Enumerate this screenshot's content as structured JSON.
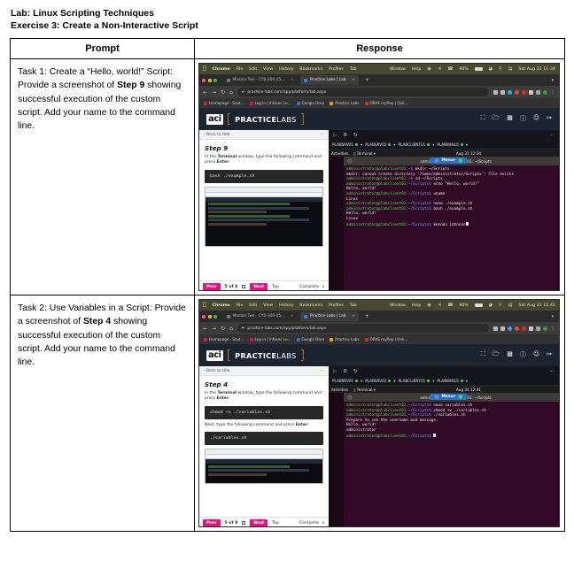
{
  "document": {
    "line1": "Lab: Linux Scripting Techniques",
    "line2": "Exercise 3: Create a Non-Interactive Script"
  },
  "table": {
    "headers": {
      "prompt": "Prompt",
      "response": "Response"
    },
    "rows": [
      {
        "prompt": {
          "part1": "Task 1: Create a “Hello, world!” Script: Provide a screenshot of ",
          "bold": "Step 9",
          "part2": " showing successful execution of the custom script. Add your name to the command line."
        }
      },
      {
        "prompt": {
          "part1": "Task 2: Use Variables in a Script: Provide a screenshot of ",
          "bold": "Step 4",
          "part2": " showing successful execution of the custom script. Add your name to the command line."
        }
      }
    ]
  },
  "screenshot1": {
    "macbar": {
      "apple": "",
      "items": [
        "Chrome",
        "File",
        "Edit",
        "View",
        "History",
        "Bookmarks",
        "Profiles",
        "Tab"
      ],
      "right_items": [
        "Window",
        "Help"
      ],
      "battery_pct": "90%",
      "clock": "Sat Aug 31  11:34"
    },
    "tabs": [
      {
        "title": "Module Two - CYB-300-15...",
        "active": false
      },
      {
        "title": "Practice Labs | Lab",
        "active": true
      }
    ],
    "omnibox": {
      "url": "practice-labs.com/app/platform/lab.aspx",
      "lock": "⚿"
    },
    "bookmarks": [
      "Homepage - Sout...",
      "Log in | Infosec Le...",
      "Google Docs",
      "Practice Labs",
      "ORAS myRep | Onli..."
    ],
    "app_header": {
      "logo_mark": "aci",
      "brand_bold": "PRACTICE",
      "brand_light": "LABS",
      "bracket_left": "[",
      "bracket_right": "]",
      "icons": [
        "fullscreen-icon",
        "folder-icon",
        "chart-icon",
        "help-icon",
        "user-icon",
        "logout-icon"
      ]
    },
    "left_pane": {
      "back_label": "Back to title",
      "step_title": "Step 9",
      "instruction_pre": "In the ",
      "instruction_bold1": "Terminal",
      "instruction_mid": " window, type the following command and press ",
      "instruction_bold2": "Enter",
      "instruction_post": ":",
      "code1": "bash ./example.sh"
    },
    "nav": {
      "prev": "Prev",
      "counter": "5 of 8",
      "next": "Next",
      "top": "Top",
      "complete": "Complete",
      "close": "×"
    },
    "vm_tabs": [
      "PLABSRV01",
      "PLABSRV02",
      "PLABCLIENT01",
      "PLABWIN10"
    ],
    "ubuntu": {
      "activities": "Activities",
      "app_menu": "Terminal",
      "clock": "Aug 31  12:34",
      "window_title": "administrator@plabclient01: ~/Scripts",
      "menu_pill": "Menu▾",
      "terminal_lines": [
        {
          "prompt": "administrator@plabclient01:~$",
          "cmd": " mkdir ~/Scripts"
        },
        {
          "out": "mkdir: cannot create directory ‘/home/administrator/Scripts’: File exists"
        },
        {
          "prompt": "administrator@plabclient01:~$",
          "cmd": " cd ~/Scripts"
        },
        {
          "prompt": "administrator@plabclient01:~/Scripts$",
          "cmd": " echo \"Hello, world!\""
        },
        {
          "out": "Hello, world!"
        },
        {
          "prompt": "administrator@plabclient01:~/Scripts$",
          "cmd": " uname"
        },
        {
          "out": "Linux"
        },
        {
          "prompt": "administrator@plabclient01:~/Scripts$",
          "cmd": " nano ./example.sh"
        },
        {
          "prompt": "administrator@plabclient01:~/Scripts$",
          "cmd": " bash ./example.sh"
        },
        {
          "out": "Hello, world!"
        },
        {
          "out": "Linux"
        },
        {
          "prompt": "administrator@plabclient01:~/Scripts$",
          "cmd": " keenan johnson",
          "cursor": true
        }
      ]
    }
  },
  "screenshot2": {
    "macbar": {
      "apple": "",
      "items": [
        "Chrome",
        "File",
        "Edit",
        "View",
        "History",
        "Bookmarks",
        "Profiles",
        "Tab"
      ],
      "right_items": [
        "Window",
        "Help"
      ],
      "battery_pct": "90%",
      "clock": "Sat Aug 31  11:41"
    },
    "tabs": [
      {
        "title": "Module Two - CYB-300-15...",
        "active": false
      },
      {
        "title": "Practice Labs | Lab",
        "active": true
      }
    ],
    "omnibox": {
      "url": "practice-labs.com/app/platform/lab.aspx",
      "lock": "⚿"
    },
    "bookmarks": [
      "Homepage - Sout...",
      "Log in | Infosec Le...",
      "Google Docs",
      "Practice Labs",
      "ORAS myRep | Onli..."
    ],
    "app_header": {
      "logo_mark": "aci",
      "brand_bold": "PRACTICE",
      "brand_light": "LABS",
      "bracket_left": "[",
      "bracket_right": "]"
    },
    "left_pane": {
      "back_label": "Back to title",
      "step_title": "Step 4",
      "instruction_pre": "In the ",
      "instruction_bold1": "Terminal",
      "instruction_mid": " window, type the following command and press ",
      "instruction_bold2": "Enter",
      "instruction_post": ":",
      "code1": "chmod +x ./variables.sh",
      "instruction2_pre": "Next, type the following command and press ",
      "instruction2_bold": "Enter",
      "instruction2_post": ":",
      "code2": "./variables.sh"
    },
    "nav": {
      "prev": "Prev",
      "counter": "5 of 8",
      "next": "Next",
      "top": "Top",
      "complete": "Complete",
      "close": "×"
    },
    "vm_tabs": [
      "PLABSRV01",
      "PLABSRV02",
      "PLABCLIENT01",
      "PLABWIN10"
    ],
    "ubuntu": {
      "activities": "Activities",
      "app_menu": "Terminal",
      "clock": "Aug 31  12:41",
      "window_title": "administrator@plabclient01: ~/Scripts",
      "menu_pill": "Menu▾",
      "terminal_lines": [
        {
          "prompt": "administrator@plabclient01:~/Scripts$",
          "cmd": " nano variables.sh"
        },
        {
          "prompt": "administrator@plabclient01:~/Scripts$",
          "cmd": " chmod +x ./variables.sh"
        },
        {
          "prompt": "administrator@plabclient01:~/Scripts$",
          "cmd": " ./variables.sh"
        },
        {
          "out": "Prepare to see the username and message."
        },
        {
          "out": "Hello, world!"
        },
        {
          "out": "administrator"
        },
        {
          "prompt": "administrator@plabclient01:~/Scripts$",
          "cmd": " ",
          "cursor": true
        }
      ]
    }
  },
  "colors": {
    "brand_orange": "#f2a01d",
    "nav_pink": "#e4147f",
    "terminal_bg": "#300a24",
    "app_header_bg": "#1c2430",
    "prompt_green": "#4ee24e",
    "dir_blue": "#6d9eff"
  }
}
